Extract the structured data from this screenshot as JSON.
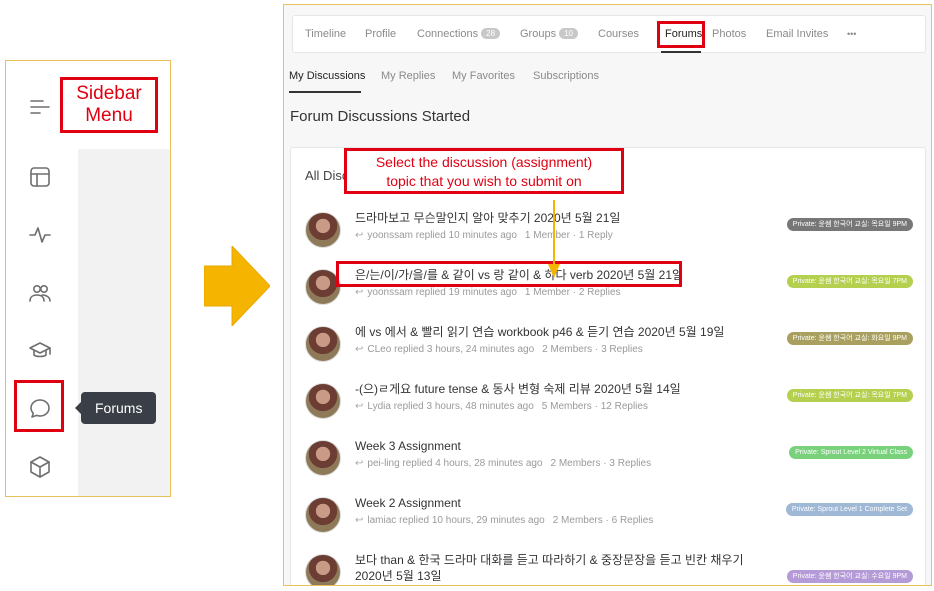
{
  "sidebar": {
    "callout": "Sidebar\nMenu",
    "icons": [
      "menu-icon",
      "layout-icon",
      "activity-icon",
      "members-icon",
      "courses-icon",
      "forums-icon",
      "package-icon"
    ],
    "tooltip": "Forums"
  },
  "top_nav": {
    "items": [
      "Timeline",
      "Profile",
      "Connections",
      "Groups",
      "Courses",
      "Forums",
      "Photos",
      "Email Invites",
      "•••"
    ],
    "connections_count": "28",
    "groups_count": "10"
  },
  "sub_nav": {
    "items": [
      "My Discussions",
      "My Replies",
      "My Favorites",
      "Subscriptions"
    ]
  },
  "page": {
    "section_title": "Forum Discussions Started",
    "list_heading": "All Disc"
  },
  "annotation": {
    "callout_line1": "Select the discussion (assignment)",
    "callout_line2": "topic that you wish to submit on"
  },
  "discussions": [
    {
      "title": "드라마보고 무슨말인지 알아 맞추기 2020년 5월 21일",
      "user": "yoonssam replied 10 minutes ago",
      "members": "1 Member · 1 Reply",
      "badge": "Private: 윤쌤 한국어 교실: 목요일 9PM",
      "badge_color": "#777777"
    },
    {
      "title": "은/는/이/가/을/를 & 같이 vs 랑 같이 & 하다 verb 2020년 5월 21일",
      "user": "yoonssam replied 19 minutes ago",
      "members": "1 Member · 2 Replies",
      "badge": "Private: 윤쌤 한국어 교실: 목요일 7PM",
      "badge_color": "#b5cf4f"
    },
    {
      "title": "에 vs 에서 & 빨리 읽기 연습 workbook p46 & 듣기 연습 2020년 5월 19일",
      "user": "CLeo replied 3 hours, 24 minutes ago",
      "members": "2 Members · 3 Replies",
      "badge": "Private: 윤쌤 한국어 교실: 화요일 9PM",
      "badge_color": "#a99f5e"
    },
    {
      "title": "-(으)ㄹ게요 future tense & 동사 변형 숙제 리뷰 2020년 5월 14일",
      "user": "Lydia replied 3 hours, 48 minutes ago",
      "members": "5 Members · 12 Replies",
      "badge": "Private: 윤쌤 한국어 교실: 목요일 7PM",
      "badge_color": "#b5cf4f"
    },
    {
      "title": "Week 3 Assignment",
      "user": "pei-ling replied 4 hours, 28 minutes ago",
      "members": "2 Members · 3 Replies",
      "badge": "Private: Sprout Level 2 Virtual Class",
      "badge_color": "#79d17c"
    },
    {
      "title": "Week 2 Assignment",
      "user": "lamiac replied 10 hours, 29 minutes ago",
      "members": "2 Members · 6 Replies",
      "badge": "Private: Sprout Level 1 Complete Set",
      "badge_color": "#9fb8d6"
    },
    {
      "title": "보다 than & 한국 드라마 대화를 듣고 따라하기 & 중장문장을 듣고 빈칸 채우기 2020년 5월 13일",
      "user": "",
      "members": "",
      "badge": "Private: 윤쌤 한국어 교실: 수요일 9PM",
      "badge_color": "#b49ad6"
    }
  ],
  "colors": {
    "annotation_red": "#e00012",
    "arrow_orange": "#f5b400",
    "panel_border": "#e8c15a"
  }
}
